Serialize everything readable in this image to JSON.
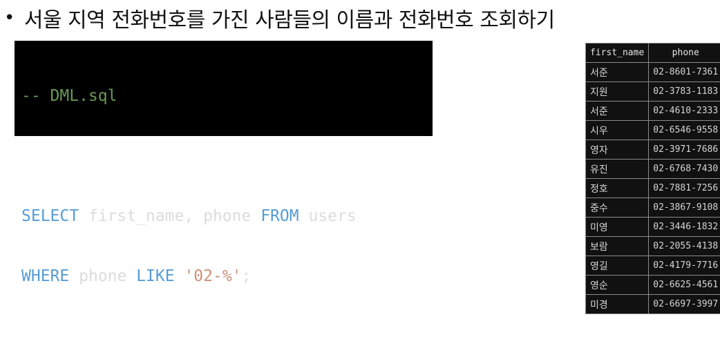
{
  "heading": {
    "bullet": "•",
    "text": "서울 지역 전화번호를 가진 사람들의 이름과 전화번호 조회하기"
  },
  "code": {
    "comment": "-- DML.sql",
    "line2": {
      "kw_select": "SELECT",
      "columns": " first_name, phone ",
      "kw_from": "FROM",
      "table": " users"
    },
    "line3": {
      "kw_where": "WHERE",
      "col": " phone ",
      "kw_like": "LIKE",
      "space": " ",
      "pattern": "'02-%'",
      "end": ";"
    }
  },
  "result_table": {
    "headers": [
      "first_name",
      "phone"
    ],
    "rows": [
      {
        "first_name": "서준",
        "phone": "02-8601-7361"
      },
      {
        "first_name": "지원",
        "phone": "02-3783-1183"
      },
      {
        "first_name": "서준",
        "phone": "02-4610-2333"
      },
      {
        "first_name": "시우",
        "phone": "02-6546-9558"
      },
      {
        "first_name": "영자",
        "phone": "02-3971-7686"
      },
      {
        "first_name": "유진",
        "phone": "02-6768-7430"
      },
      {
        "first_name": "정호",
        "phone": "02-7881-7256"
      },
      {
        "first_name": "중수",
        "phone": "02-3867-9108"
      },
      {
        "first_name": "미영",
        "phone": "02-3446-1832"
      },
      {
        "first_name": "보람",
        "phone": "02-2055-4138"
      },
      {
        "first_name": "영길",
        "phone": "02-4179-7716"
      },
      {
        "first_name": "영순",
        "phone": "02-6625-4561"
      },
      {
        "first_name": "미경",
        "phone": "02-6697-3997"
      }
    ]
  }
}
